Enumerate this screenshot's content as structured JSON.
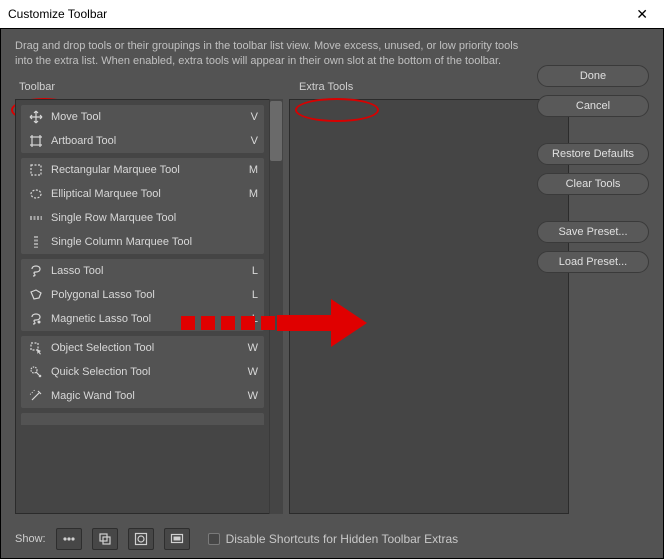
{
  "window": {
    "title": "Customize Toolbar"
  },
  "description": "Drag and drop tools or their groupings in the toolbar list view. Move excess, unused, or low priority tools into the extra list. When enabled, extra tools will appear in their own slot at the bottom of the toolbar.",
  "columns": {
    "toolbar": "Toolbar",
    "extra": "Extra Tools"
  },
  "groups": [
    {
      "tools": [
        {
          "icon": "move",
          "label": "Move Tool",
          "key": "V"
        },
        {
          "icon": "artboard",
          "label": "Artboard Tool",
          "key": "V"
        }
      ]
    },
    {
      "tools": [
        {
          "icon": "rect-marquee",
          "label": "Rectangular Marquee Tool",
          "key": "M"
        },
        {
          "icon": "ellipse-marquee",
          "label": "Elliptical Marquee Tool",
          "key": "M"
        },
        {
          "icon": "row-marquee",
          "label": "Single Row Marquee Tool",
          "key": ""
        },
        {
          "icon": "col-marquee",
          "label": "Single Column Marquee Tool",
          "key": ""
        }
      ]
    },
    {
      "tools": [
        {
          "icon": "lasso",
          "label": "Lasso Tool",
          "key": "L"
        },
        {
          "icon": "poly-lasso",
          "label": "Polygonal Lasso Tool",
          "key": "L"
        },
        {
          "icon": "mag-lasso",
          "label": "Magnetic Lasso Tool",
          "key": "L"
        }
      ]
    },
    {
      "tools": [
        {
          "icon": "obj-select",
          "label": "Object Selection Tool",
          "key": "W"
        },
        {
          "icon": "quick-select",
          "label": "Quick Selection Tool",
          "key": "W"
        },
        {
          "icon": "magic-wand",
          "label": "Magic Wand Tool",
          "key": "W"
        }
      ]
    }
  ],
  "buttons": {
    "done": "Done",
    "cancel": "Cancel",
    "restore": "Restore Defaults",
    "clear": "Clear Tools",
    "save": "Save Preset...",
    "load": "Load Preset..."
  },
  "bottom": {
    "show": "Show:",
    "disable": "Disable Shortcuts for Hidden Toolbar Extras"
  }
}
